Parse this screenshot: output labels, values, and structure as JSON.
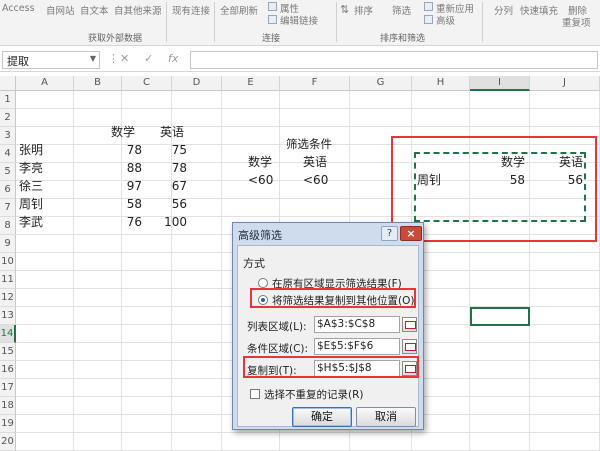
{
  "ribbon": {
    "items": [
      "Access",
      "自网站",
      "自文本",
      "自其他来源",
      "现有连接",
      "全部刷新",
      "属性",
      "编辑链接",
      "排序",
      "筛选",
      "重新应用",
      "高级",
      "分列",
      "快速填充",
      "删除",
      "重复项"
    ],
    "group_labels": [
      "获取外部数据",
      "连接",
      "排序和筛选"
    ]
  },
  "formula_bar": {
    "name_box": "提取",
    "fx_label": "fx",
    "formula": ""
  },
  "columns": [
    "A",
    "B",
    "C",
    "D",
    "E",
    "F",
    "G",
    "H",
    "I",
    "J"
  ],
  "selected_column": "I",
  "rows": [
    "1",
    "2",
    "3",
    "4",
    "5",
    "6",
    "7",
    "8",
    "9",
    "10",
    "11",
    "12",
    "13",
    "14",
    "15",
    "16",
    "17",
    "18",
    "19",
    "20",
    "21"
  ],
  "selected_row": "14",
  "sheet": {
    "headers": {
      "b3": "数学",
      "c3": "英语"
    },
    "students": [
      {
        "name": "张明",
        "math": "78",
        "eng": "75"
      },
      {
        "name": "李亮",
        "math": "88",
        "eng": "78"
      },
      {
        "name": "徐三",
        "math": "97",
        "eng": "67"
      },
      {
        "name": "周钊",
        "math": "58",
        "eng": "56"
      },
      {
        "name": "李武",
        "math": "76",
        "eng": "100"
      }
    ],
    "criteria_title": "筛选条件",
    "criteria_headers": {
      "e5": "数学",
      "f5": "英语"
    },
    "criteria_values": {
      "e6": "<60",
      "f6": "<60"
    },
    "result_headers": {
      "i5": "数学",
      "j5": "英语"
    },
    "result_row": {
      "h6": "周钊",
      "i6": "58",
      "j6": "56"
    }
  },
  "dialog": {
    "title": "高级筛选",
    "help": "?",
    "close": "×",
    "method_label": "方式",
    "option_inplace": "在原有区域显示筛选结果(F)",
    "option_copy": "将筛选结果复制到其他位置(O)",
    "list_range_label": "列表区域(L):",
    "list_range_value": "$A$3:$C$8",
    "criteria_range_label": "条件区域(C):",
    "criteria_range_value": "$E$5:$F$6",
    "copy_to_label": "复制到(T):",
    "copy_to_value": "$H$5:$J$8",
    "unique_label": "选择不重复的记录(R)",
    "ok": "确定",
    "cancel": "取消"
  },
  "colors": {
    "accent": "#217346",
    "highlight_red": "#e8343a"
  }
}
